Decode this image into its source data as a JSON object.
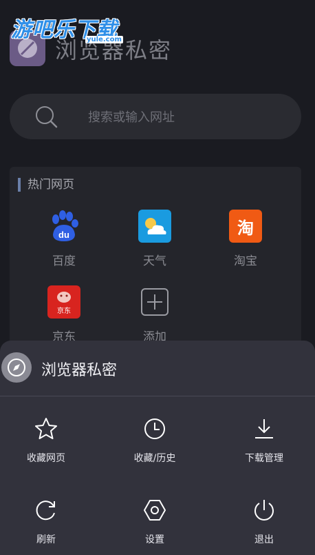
{
  "watermark": {
    "brand": "游吧乐下载",
    "domain": "yule.com"
  },
  "header": {
    "title": "浏览器私密",
    "logo_icon": "app-logo-icon"
  },
  "search": {
    "placeholder": "搜索或输入网址",
    "icon": "search-icon"
  },
  "hot": {
    "title": "热门网页",
    "sites": [
      {
        "label": "百度",
        "icon": "baidu-icon",
        "icon_text": "du",
        "color": "#2f5fe3"
      },
      {
        "label": "天气",
        "icon": "weather-icon",
        "color": "#1a9be0"
      },
      {
        "label": "淘宝",
        "icon": "taobao-icon",
        "icon_text": "淘",
        "color": "#f05a14"
      },
      {
        "label": "京东",
        "icon": "jd-icon",
        "icon_text": "京东",
        "color": "#d8241f"
      },
      {
        "label": "添加",
        "icon": "add-icon"
      }
    ]
  },
  "sheet": {
    "title": "浏览器私密",
    "logo_icon": "compass-icon",
    "items": [
      {
        "label": "收藏网页",
        "icon": "star-icon"
      },
      {
        "label": "收藏/历史",
        "icon": "clock-icon"
      },
      {
        "label": "下载管理",
        "icon": "download-icon"
      },
      {
        "label": "刷新",
        "icon": "refresh-icon"
      },
      {
        "label": "设置",
        "icon": "settings-icon"
      },
      {
        "label": "退出",
        "icon": "power-icon"
      }
    ]
  }
}
